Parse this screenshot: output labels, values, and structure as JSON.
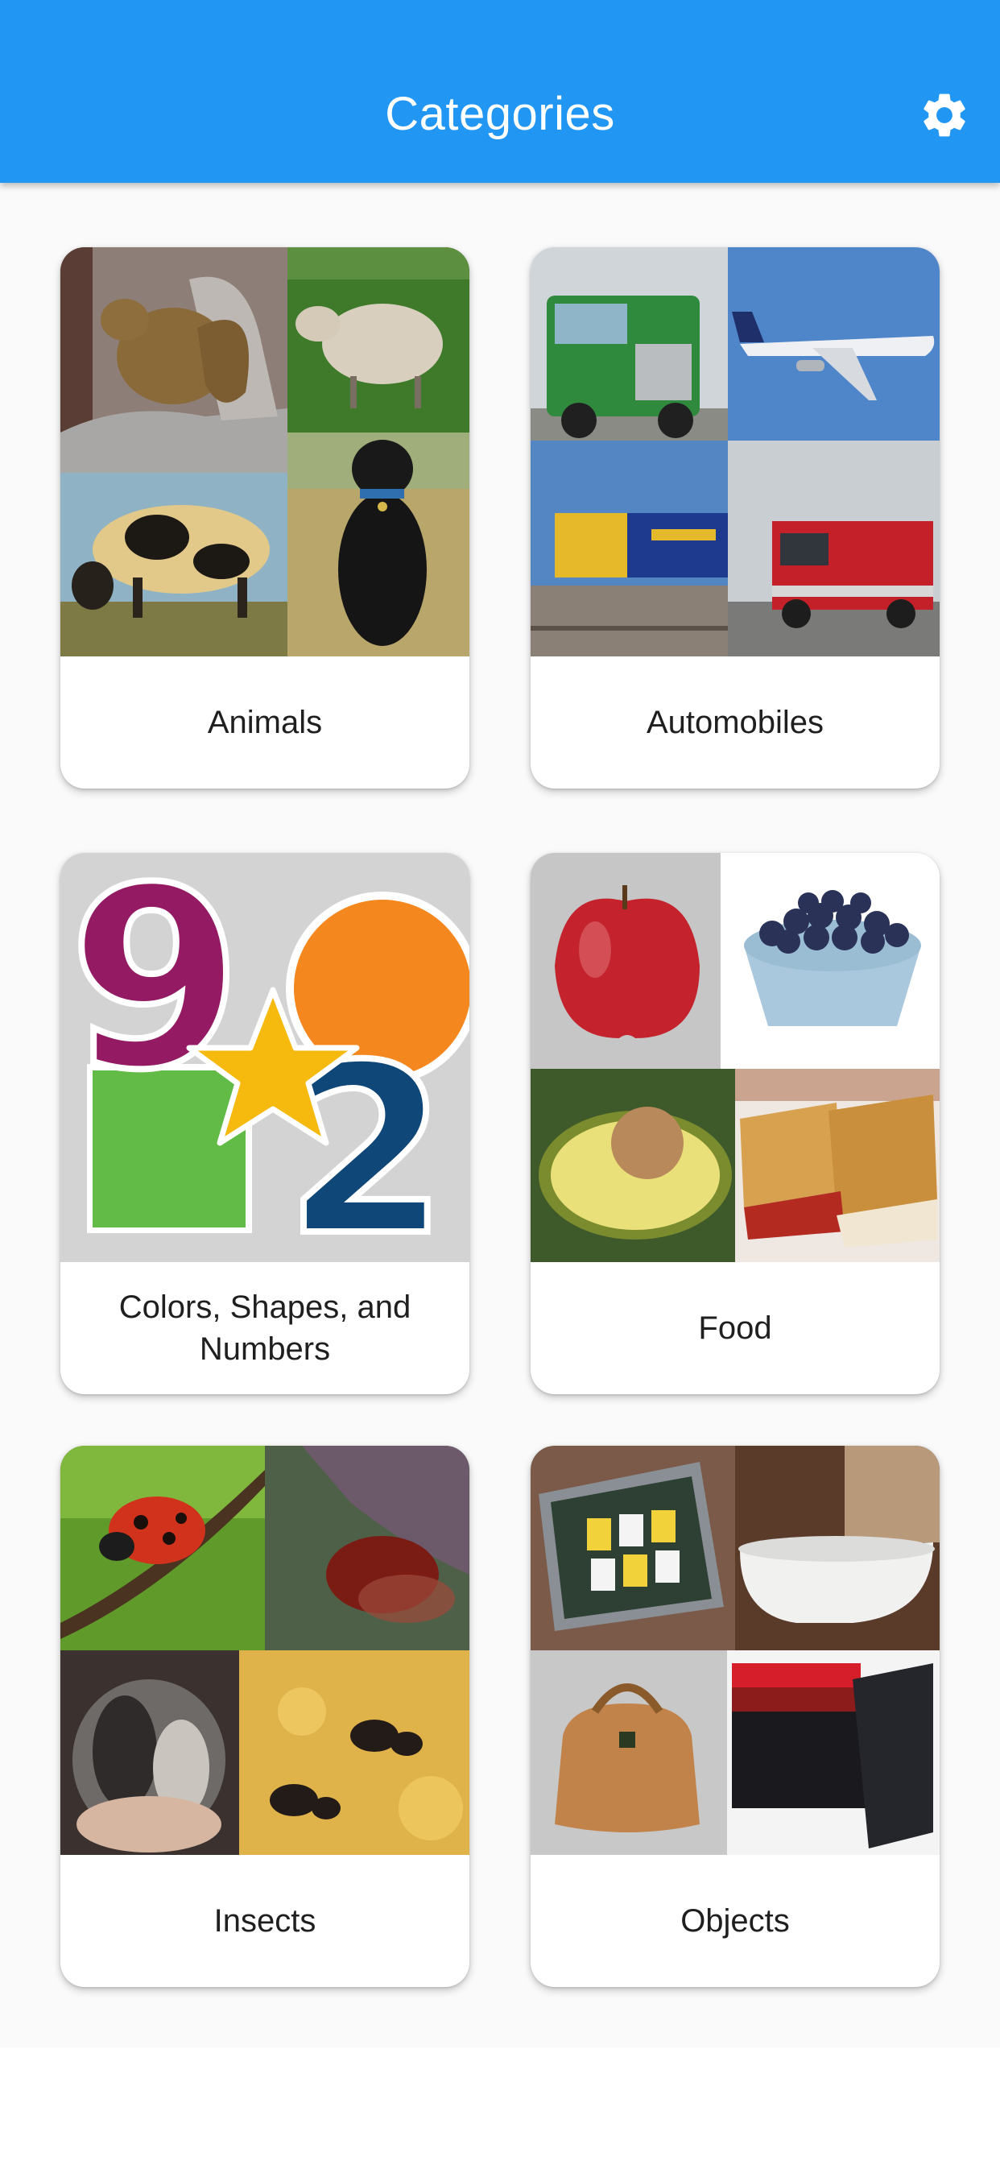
{
  "appbar": {
    "title": "Categories",
    "settings_icon": "gear-icon",
    "background": "#2196F3"
  },
  "categories": [
    {
      "label": "Animals"
    },
    {
      "label": "Automobiles"
    },
    {
      "label": "Colors, Shapes, and Numbers"
    },
    {
      "label": "Food"
    },
    {
      "label": "Insects"
    },
    {
      "label": "Objects"
    }
  ]
}
